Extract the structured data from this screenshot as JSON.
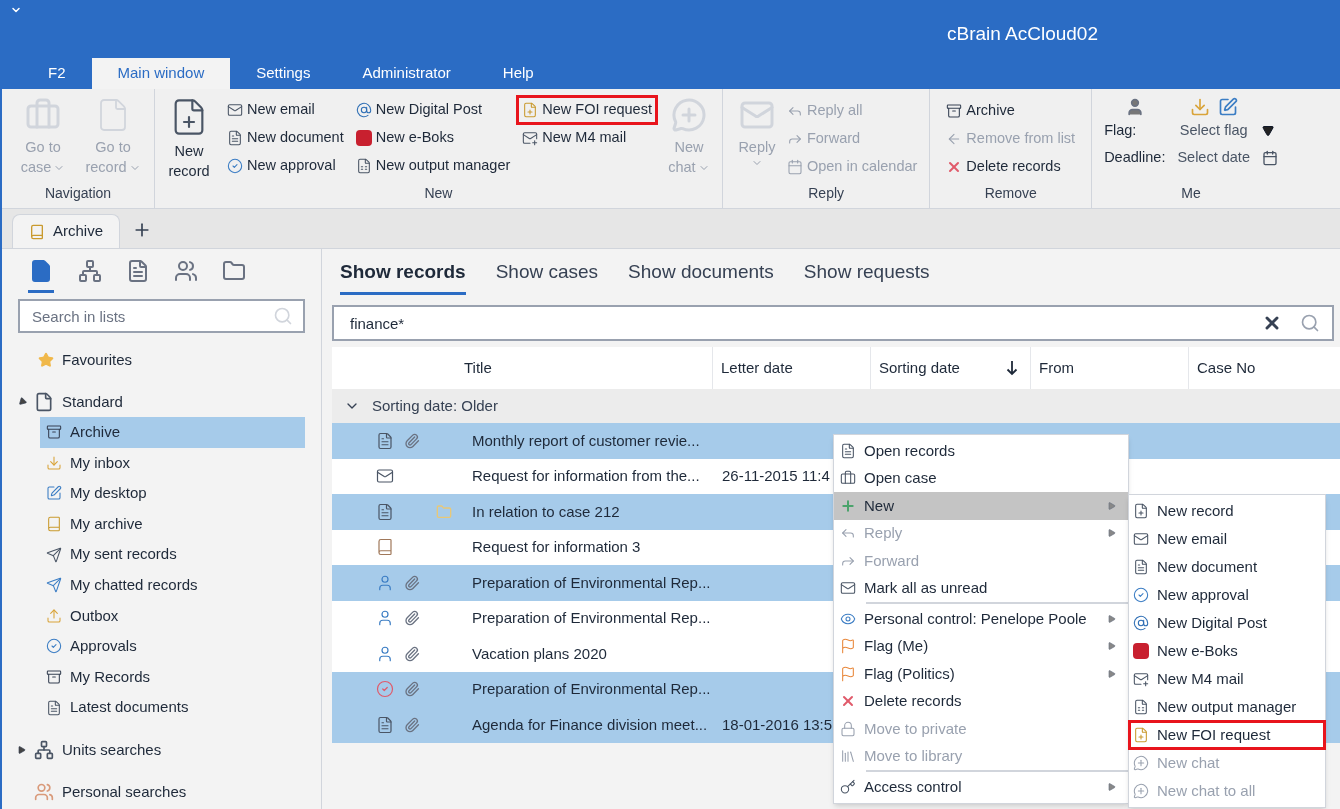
{
  "window": {
    "title": "cBrain AcCloud02"
  },
  "menu_tabs": [
    {
      "label": "F2",
      "selected": false
    },
    {
      "label": "Main window",
      "selected": true
    },
    {
      "label": "Settings",
      "selected": false
    },
    {
      "label": "Administrator",
      "selected": false
    },
    {
      "label": "Help",
      "selected": false
    }
  ],
  "ribbon": {
    "navigation": {
      "label": "Navigation",
      "buttons": [
        {
          "kind": "case",
          "label": "Go to case",
          "disabled": true
        },
        {
          "kind": "record",
          "label": "Go to record",
          "disabled": true
        }
      ]
    },
    "new": {
      "label": "New",
      "big": {
        "label": "New record",
        "disabled": false
      },
      "items": [
        {
          "kind": "email",
          "label": "New email",
          "disabled": false,
          "highlighted": false
        },
        {
          "kind": "document",
          "label": "New document",
          "disabled": false,
          "highlighted": false
        },
        {
          "kind": "approval",
          "label": "New approval",
          "disabled": false,
          "highlighted": false
        },
        {
          "kind": "digital",
          "label": "New Digital Post",
          "disabled": false,
          "highlighted": false
        },
        {
          "kind": "eboks",
          "label": "New e-Boks",
          "disabled": false,
          "highlighted": false
        },
        {
          "kind": "output",
          "label": "New output manager",
          "disabled": false,
          "highlighted": false
        },
        {
          "kind": "foi",
          "label": "New FOI request",
          "disabled": false,
          "highlighted": true
        },
        {
          "kind": "m4",
          "label": "New M4 mail",
          "disabled": false,
          "highlighted": false
        }
      ],
      "chat": {
        "label": "New chat",
        "disabled": true
      }
    },
    "reply": {
      "label": "Reply",
      "big": {
        "label": "Reply",
        "disabled": true
      },
      "items": [
        {
          "kind": "replyall",
          "label": "Reply all",
          "disabled": true
        },
        {
          "kind": "forward",
          "label": "Forward",
          "disabled": true
        },
        {
          "kind": "calendar",
          "label": "Open in calendar",
          "disabled": true
        }
      ]
    },
    "remove": {
      "label": "Remove",
      "items": [
        {
          "kind": "archive",
          "label": "Archive",
          "disabled": false
        },
        {
          "kind": "remove",
          "label": "Remove from list",
          "disabled": true
        },
        {
          "kind": "delete",
          "label": "Delete records",
          "disabled": false
        }
      ]
    },
    "me": {
      "label": "Me",
      "flag_label": "Flag:",
      "flag_value": "Select flag",
      "deadline_label": "Deadline:",
      "deadline_value": "Select date"
    }
  },
  "doc_tabs": [
    {
      "label": "Archive",
      "selected": true
    }
  ],
  "sidebar": {
    "search": {
      "placeholder": "Search in lists"
    },
    "favourites": "Favourites",
    "standard": {
      "label": "Standard",
      "expanded": true,
      "children": [
        {
          "kind": "archive",
          "label": "Archive",
          "selected": true
        },
        {
          "kind": "inbox",
          "label": "My inbox",
          "selected": false
        },
        {
          "kind": "desktop",
          "label": "My desktop",
          "selected": false
        },
        {
          "kind": "myarchive",
          "label": "My archive",
          "selected": false
        },
        {
          "kind": "sent",
          "label": "My sent records",
          "selected": false
        },
        {
          "kind": "chatted",
          "label": "My chatted records",
          "selected": false
        },
        {
          "kind": "outbox",
          "label": "Outbox",
          "selected": false
        },
        {
          "kind": "approvals",
          "label": "Approvals",
          "selected": false
        },
        {
          "kind": "archive",
          "label": "My Records",
          "selected": false
        },
        {
          "kind": "latest",
          "label": "Latest documents",
          "selected": false
        }
      ]
    },
    "units": {
      "label": "Units searches",
      "expanded": false
    },
    "personal": "Personal searches"
  },
  "view_tabs": [
    {
      "label": "Show records",
      "selected": true
    },
    {
      "label": "Show cases",
      "selected": false
    },
    {
      "label": "Show documents",
      "selected": false
    },
    {
      "label": "Show requests",
      "selected": false
    }
  ],
  "search": {
    "value": "finance*"
  },
  "table": {
    "columns": [
      "Title",
      "Letter date",
      "Sorting date",
      "From",
      "Case No"
    ],
    "group": "Sorting date:  Older",
    "rows": [
      {
        "selected": true,
        "kind": "document",
        "attachment": true,
        "folder": false,
        "title": "Monthly report of customer revie..."
      },
      {
        "selected": false,
        "kind": "email",
        "attachment": false,
        "folder": false,
        "title": "Request for information from the...",
        "letter_date": "26-11-2015 11:4"
      },
      {
        "selected": true,
        "kind": "document",
        "attachment": false,
        "folder": true,
        "title": "In relation to case 212"
      },
      {
        "selected": false,
        "kind": "request",
        "attachment": false,
        "folder": false,
        "title": "Request for information 3"
      },
      {
        "selected": true,
        "kind": "person",
        "attachment": true,
        "folder": false,
        "title": "Preparation of Environmental Rep..."
      },
      {
        "selected": false,
        "kind": "person",
        "attachment": true,
        "folder": false,
        "title": "Preparation of Environmental Rep..."
      },
      {
        "selected": false,
        "kind": "person",
        "attachment": true,
        "folder": false,
        "title": "Vacation plans 2020"
      },
      {
        "selected": true,
        "kind": "approved",
        "attachment": true,
        "folder": false,
        "title": "Preparation of Environmental Rep..."
      },
      {
        "selected": true,
        "kind": "document",
        "attachment": true,
        "folder": false,
        "title": "Agenda for Finance division meet...",
        "letter_date": "18-01-2016 13:5"
      }
    ]
  },
  "context_menu": {
    "groups": [
      [
        {
          "kind": "document",
          "label": "Open records",
          "disabled": false,
          "submenu": false,
          "active": false
        },
        {
          "kind": "case",
          "label": "Open case",
          "disabled": false,
          "submenu": false,
          "active": false
        },
        {
          "kind": "plus",
          "label": "New",
          "disabled": false,
          "submenu": true,
          "active": true
        },
        {
          "kind": "reply",
          "label": "Reply",
          "disabled": true,
          "submenu": true,
          "active": false
        },
        {
          "kind": "forward",
          "label": "Forward",
          "disabled": true,
          "submenu": false,
          "active": false
        },
        {
          "kind": "mail",
          "label": "Mark all as unread",
          "disabled": false,
          "submenu": false,
          "active": false
        }
      ],
      [
        {
          "kind": "eye",
          "label": "Personal control: Penelope Poole",
          "disabled": false,
          "submenu": true,
          "active": false
        },
        {
          "kind": "flag",
          "label": "Flag (Me)",
          "disabled": false,
          "submenu": true,
          "active": false
        },
        {
          "kind": "flag",
          "label": "Flag (Politics)",
          "disabled": false,
          "submenu": true,
          "active": false
        },
        {
          "kind": "delete",
          "label": "Delete records",
          "disabled": false,
          "submenu": false,
          "active": false
        },
        {
          "kind": "private",
          "label": "Move to private",
          "disabled": true,
          "submenu": false,
          "active": false
        },
        {
          "kind": "library",
          "label": "Move to library",
          "disabled": true,
          "submenu": false,
          "active": false
        }
      ],
      [
        {
          "kind": "key",
          "label": "Access control",
          "disabled": false,
          "submenu": true,
          "active": false
        }
      ]
    ],
    "submenu": [
      {
        "kind": "record",
        "label": "New record",
        "disabled": false,
        "highlighted": false
      },
      {
        "kind": "email",
        "label": "New email",
        "disabled": false,
        "highlighted": false
      },
      {
        "kind": "document",
        "label": "New document",
        "disabled": false,
        "highlighted": false
      },
      {
        "kind": "approval",
        "label": "New approval",
        "disabled": false,
        "highlighted": false
      },
      {
        "kind": "digital",
        "label": "New Digital Post",
        "disabled": false,
        "highlighted": false
      },
      {
        "kind": "eboks",
        "label": "New e-Boks",
        "disabled": false,
        "highlighted": false
      },
      {
        "kind": "m4",
        "label": "New M4 mail",
        "disabled": false,
        "highlighted": false
      },
      {
        "kind": "output",
        "label": "New output manager",
        "disabled": false,
        "highlighted": false
      },
      {
        "kind": "foi",
        "label": "New FOI request",
        "disabled": false,
        "highlighted": true
      },
      {
        "kind": "chat",
        "label": "New chat",
        "disabled": true,
        "highlighted": false
      },
      {
        "kind": "chat",
        "label": "New chat to all",
        "disabled": true,
        "highlighted": false
      }
    ]
  }
}
